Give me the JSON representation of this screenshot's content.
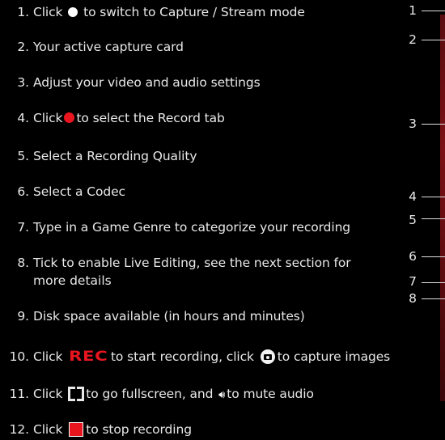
{
  "steps": [
    {
      "num": "1.",
      "before": "Click",
      "icon": "white-circle-icon",
      "after": "to switch to Capture / Stream mode"
    },
    {
      "num": "2.",
      "text": "Your active capture card"
    },
    {
      "num": "3.",
      "text": "Adjust your video and audio settings"
    },
    {
      "num": "4.",
      "before": "Click",
      "icon": "red-circle-icon",
      "after": "to select the Record tab"
    },
    {
      "num": "5.",
      "text": "Select a Recording Quality"
    },
    {
      "num": "6.",
      "text": "Select a Codec"
    },
    {
      "num": "7.",
      "text": "Type in a Game Genre to categorize your recording"
    },
    {
      "num": "8.",
      "line1": "Tick to enable Live Editing, see the next section for",
      "line2": "more details"
    },
    {
      "num": "9.",
      "text": "Disk space available (in hours and minutes)"
    },
    {
      "num": "10.",
      "before": "Click",
      "rec_label": "REC",
      "middle": "to start recording, click",
      "after": "to capture images"
    },
    {
      "num": "11.",
      "before": "Click",
      "middle": "to go fullscreen, and",
      "after": "to mute audio"
    },
    {
      "num": "12.",
      "before": "Click",
      "after": "to stop recording"
    }
  ],
  "callouts": [
    "1",
    "2",
    "3",
    "4",
    "5",
    "6",
    "7",
    "8"
  ],
  "colors": {
    "background": "#000000",
    "accent_red": "#e8151f",
    "text": "#e8e8e8"
  }
}
